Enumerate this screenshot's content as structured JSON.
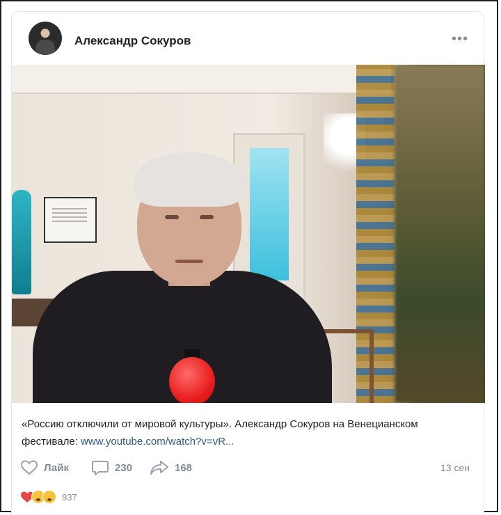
{
  "post": {
    "author": "Александр Сокуров",
    "more_label": "•••",
    "caption_text": "«Россию отключили от мировой культуры». Александр Сокуров на Венецианском фестивале: ",
    "caption_link": "www.youtube.com/watch?v=vR...",
    "date": "13 сен"
  },
  "actions": {
    "like_label": "Лайк",
    "comments_count": "230",
    "shares_count": "168"
  },
  "reactions": {
    "icons": [
      "heart-icon",
      "sad-emoji-icon",
      "wow-emoji-icon"
    ],
    "count": "937"
  },
  "colors": {
    "link": "#2a5885",
    "muted": "#818c99",
    "heart": "#e64646"
  }
}
